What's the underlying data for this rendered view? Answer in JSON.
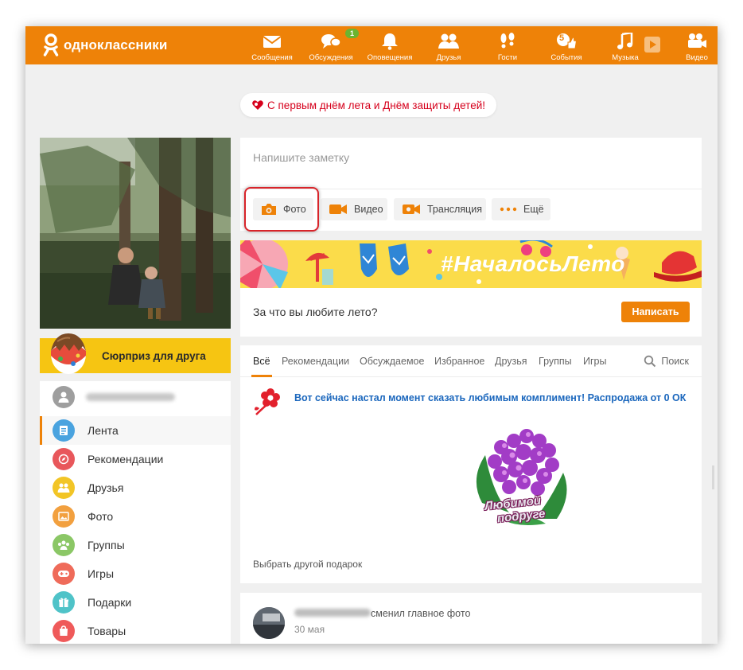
{
  "brand": {
    "name": "одноклассники"
  },
  "nav": {
    "items": [
      {
        "label": "Сообщения",
        "icon": "envelope-icon"
      },
      {
        "label": "Обсуждения",
        "icon": "chat-bubbles-icon",
        "badge": "1"
      },
      {
        "label": "Оповещения",
        "icon": "bell-icon"
      },
      {
        "label": "Друзья",
        "icon": "people-icon"
      },
      {
        "label": "Гости",
        "icon": "footprints-icon"
      },
      {
        "label": "События",
        "icon": "thumbs-up-icon",
        "badge": "5"
      },
      {
        "label": "Музыка",
        "icon": "music-note-icon"
      },
      {
        "label": "",
        "icon": "play-icon"
      },
      {
        "label": "Видео",
        "icon": "camera-icon"
      }
    ]
  },
  "holiday_banner": {
    "text": "С первым днём лета и Днём защиты детей!"
  },
  "surprise": {
    "label": "Сюрприз для друга"
  },
  "sidebar": {
    "items": [
      {
        "label": "Лента",
        "icon": "feed-icon",
        "color": "#4aa3df"
      },
      {
        "label": "Рекомендации",
        "icon": "compass-icon",
        "color": "#e8575b"
      },
      {
        "label": "Друзья",
        "icon": "friends-icon",
        "color": "#f2c526"
      },
      {
        "label": "Фото",
        "icon": "photo-icon",
        "color": "#f2a03f"
      },
      {
        "label": "Группы",
        "icon": "groups-icon",
        "color": "#8bc766"
      },
      {
        "label": "Игры",
        "icon": "games-icon",
        "color": "#ef6b5a"
      },
      {
        "label": "Подарки",
        "icon": "gift-icon",
        "color": "#4fc3c8"
      },
      {
        "label": "Товары",
        "icon": "bag-icon",
        "color": "#ef5a5a"
      }
    ]
  },
  "composer": {
    "placeholder": "Напишите заметку",
    "buttons": [
      {
        "label": "Фото",
        "icon": "camera-icon"
      },
      {
        "label": "Видео",
        "icon": "video-icon"
      },
      {
        "label": "Трансляция",
        "icon": "broadcast-icon"
      },
      {
        "label": "Ещё",
        "icon": "more-dots-icon"
      }
    ]
  },
  "summer": {
    "hashtag": "#НачалосьЛето",
    "question": "За что вы любите лето?",
    "button": "Написать"
  },
  "feed": {
    "tabs": [
      "Всё",
      "Рекомендации",
      "Обсуждаемое",
      "Избранное",
      "Друзья",
      "Группы",
      "Игры"
    ],
    "search_label": "Поиск",
    "promo_text": "Вот сейчас настал момент сказать любимым комплимент! Распродажа от 0 ОК",
    "gift_caption_1": "Любимой",
    "gift_caption_2": "подруге",
    "other_gift": "Выбрать другой подарок"
  },
  "post": {
    "action": "сменил главное фото",
    "date": "30 мая"
  },
  "colors": {
    "brand_orange": "#ee8208",
    "link_blue": "#1b67bd",
    "holiday_red": "#d6001c"
  }
}
